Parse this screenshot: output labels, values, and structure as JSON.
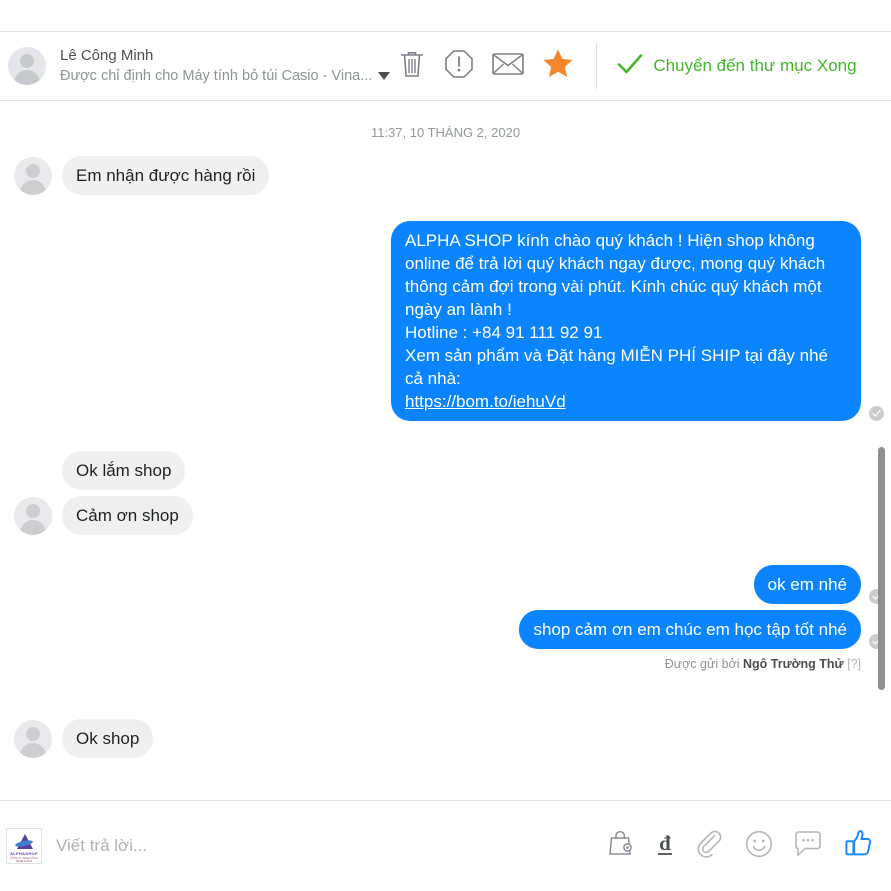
{
  "header": {
    "avatar_name": "user-avatar",
    "name": "Lê Công Minh",
    "subtitle": "Được chỉ định cho Máy tính bỏ túi Casio - Vina...",
    "caret_icon": "chevron-down-icon",
    "icons": [
      {
        "name": "trash-icon",
        "label": "Xóa"
      },
      {
        "name": "warning-icon",
        "label": "Đánh dấu spam"
      },
      {
        "name": "envelope-icon",
        "label": "Đánh dấu chưa đọc"
      },
      {
        "name": "star-icon",
        "label": "Gắn sao",
        "color": "#f7852c"
      }
    ],
    "status": {
      "check_icon": "check-icon",
      "text": "Chuyển đến thư mục Xong",
      "color": "#42b72a"
    }
  },
  "thread": {
    "timestamp": "11:37, 10 THÁNG 2, 2020",
    "messages": [
      {
        "id": "msg-1",
        "direction": "in",
        "avatar": true,
        "text": "Em nhận được hàng rồi"
      },
      {
        "id": "msg-2",
        "direction": "out",
        "seen": true,
        "lines": [
          "ALPHA SHOP  kính chào quý khách ! Hiện shop không online để trả lời quý khách ngay được, mong quý khách thông cảm đợi trong vài phút. Kính chúc quý khách một ngày an lành !",
          "Hotline : +84 91 111 92 91",
          "Xem sản phẩm và Đặt hàng MIỄN PHÍ SHIP tại đây nhé cả nhà:"
        ],
        "link": "https://bom.to/iehuVd"
      },
      {
        "id": "msg-3",
        "direction": "in",
        "avatar": false,
        "text": "Ok lắm shop"
      },
      {
        "id": "msg-4",
        "direction": "in",
        "avatar": true,
        "text": "Cảm ơn shop"
      },
      {
        "id": "msg-5",
        "direction": "out",
        "seen": true,
        "text": "ok em  nhé"
      },
      {
        "id": "msg-6",
        "direction": "out",
        "seen": true,
        "text": "shop cảm ơn em chúc em học tập tốt nhé"
      }
    ],
    "sender_note": {
      "prefix": "Được gửi bởi",
      "name": "Ngô Trường Thử",
      "help": "[?]"
    },
    "last_message": {
      "id": "msg-7",
      "direction": "in",
      "avatar": true,
      "text": "Ok shop"
    }
  },
  "composer": {
    "avatar": {
      "name": "alphashop-logo-avatar",
      "brand": "ALPHASHOP",
      "tagline": "CÔNG TY TNHH CÔNG NGHỆ ALPHA"
    },
    "placeholder": "Viết trả lời...",
    "value": "",
    "icons": [
      {
        "name": "shopping-bag-icon",
        "label": "Sản phẩm"
      },
      {
        "name": "dong-currency-icon",
        "label": "đ"
      },
      {
        "name": "paperclip-icon",
        "label": "Đính kèm"
      },
      {
        "name": "emoji-icon",
        "label": "Biểu tượng cảm xúc"
      },
      {
        "name": "quick-reply-icon",
        "label": "Trả lời nhanh"
      },
      {
        "name": "thumbs-up-icon",
        "label": "Thích",
        "color": "#0a84ff"
      }
    ]
  },
  "colors": {
    "outgoing_bubble": "#0a84ff",
    "incoming_bubble": "#f1f0f0",
    "status_green": "#42b72a",
    "star_orange": "#f7852c",
    "thumb_blue": "#0a84ff"
  }
}
